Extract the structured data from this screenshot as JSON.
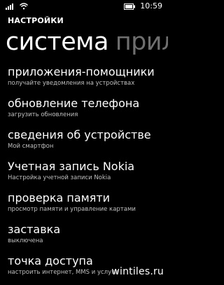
{
  "status_bar": {
    "time": "10:59",
    "icons": [
      "signal-icon",
      "wifi-icon",
      "battery-icon"
    ]
  },
  "header": {
    "app_title": "НАСТРОЙКИ"
  },
  "pivot": {
    "items": [
      {
        "label": "система",
        "active": true
      },
      {
        "label": "прилож",
        "active": false
      }
    ]
  },
  "settings": {
    "items": [
      {
        "title": "приложения-помощники",
        "subtitle": "получайте уведомления на устройствах"
      },
      {
        "title": "обновление телефона",
        "subtitle": "загрузить обновления"
      },
      {
        "title": "сведения об устройстве",
        "subtitle": "Мой смартфон"
      },
      {
        "title": "Учетная запись Nokia",
        "subtitle": "Настройка учетной записи Nokia"
      },
      {
        "title": "проверка памяти",
        "subtitle": "просмотр памяти и управление картами"
      },
      {
        "title": "заставка",
        "subtitle": "выключена"
      },
      {
        "title": "точка доступа",
        "subtitle": "настроить интернет, MMS и услуги"
      }
    ]
  },
  "watermark": {
    "text": "wintiles.ru"
  },
  "colors": {
    "background": "#000000",
    "text": "#ffffff",
    "subtitle": "#bfbfbf",
    "inactive_pivot": "#6f6f6f"
  }
}
